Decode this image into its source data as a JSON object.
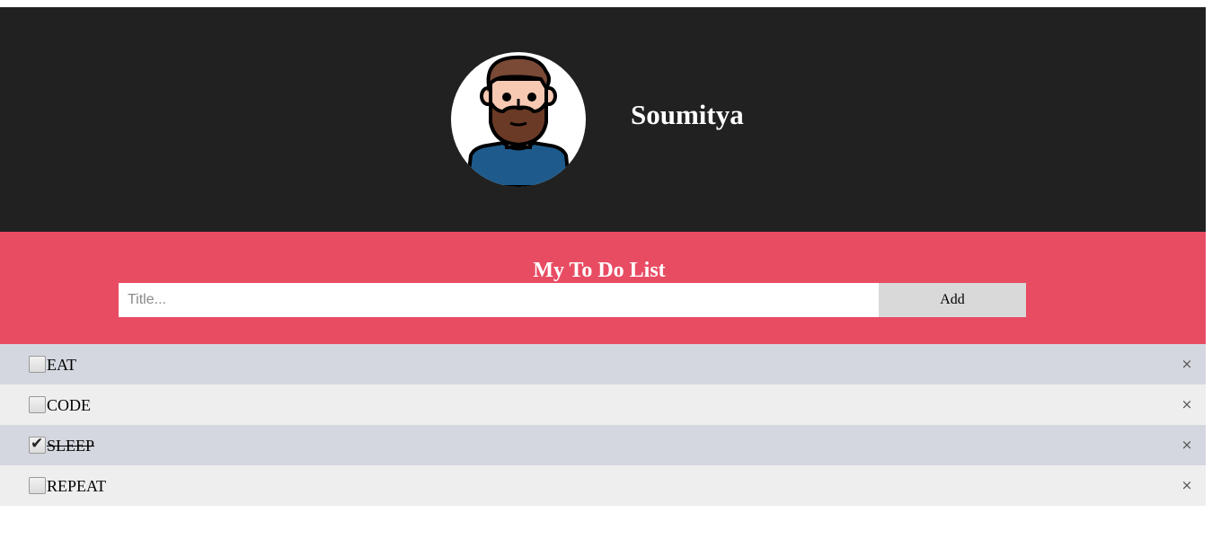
{
  "profile": {
    "name": "Soumitya",
    "avatar_icon": "bearded-man-avatar-icon"
  },
  "todo": {
    "title": "My To Do List",
    "input_placeholder": "Title...",
    "input_value": "",
    "add_label": "Add",
    "items": [
      {
        "text": "EAT",
        "checked": false
      },
      {
        "text": "CODE",
        "checked": false
      },
      {
        "text": "SLEEP",
        "checked": true
      },
      {
        "text": "REPEAT",
        "checked": false
      }
    ],
    "remove_glyph": "×",
    "check_glyph": "✔"
  },
  "colors": {
    "profile_background": "#212121",
    "header_background": "#e84c63",
    "row_odd": "#d4d7df",
    "row_even": "#eeeeee",
    "add_button": "#d9d9d9"
  }
}
